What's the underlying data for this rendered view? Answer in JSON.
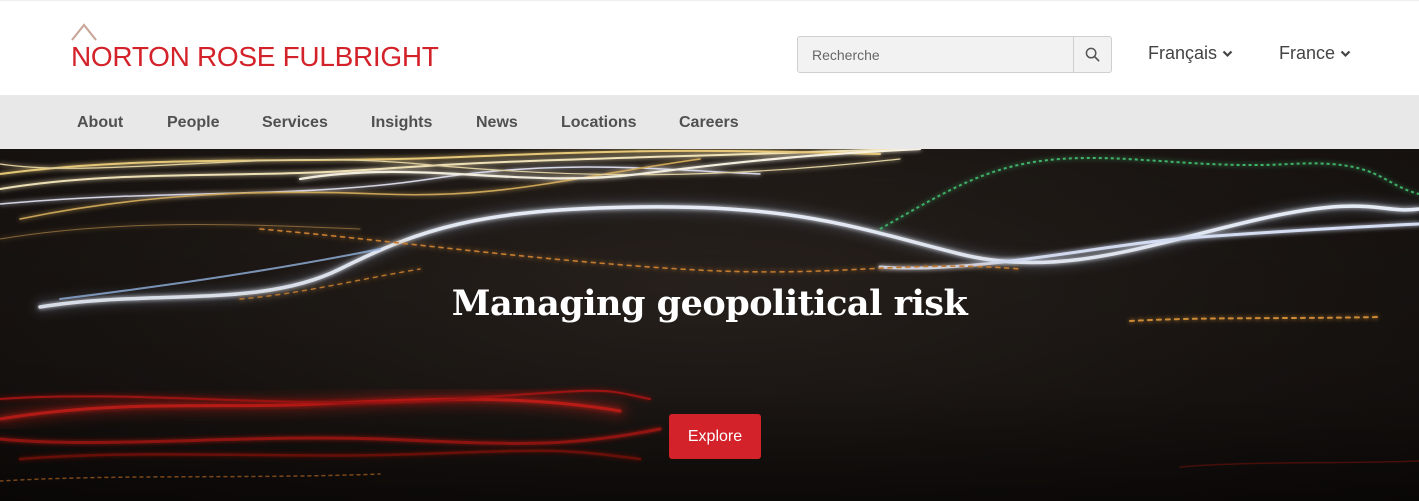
{
  "header": {
    "logo_text": "NORTON ROSE FULBRIGHT",
    "search": {
      "placeholder": "Recherche"
    },
    "language_label": "Français",
    "country_label": "France"
  },
  "nav": {
    "items": [
      {
        "label": "About"
      },
      {
        "label": "People"
      },
      {
        "label": "Services"
      },
      {
        "label": "Insights"
      },
      {
        "label": "News"
      },
      {
        "label": "Locations"
      },
      {
        "label": "Careers"
      }
    ]
  },
  "hero": {
    "title": "Managing geopolitical risk",
    "cta_label": "Explore"
  },
  "colors": {
    "brand_red": "#d3222a",
    "nav_bg": "#e8e8e8",
    "hero_bg": "#1a1512"
  },
  "icons": {
    "search": "search-icon",
    "chevron": "chevron-down-icon"
  }
}
